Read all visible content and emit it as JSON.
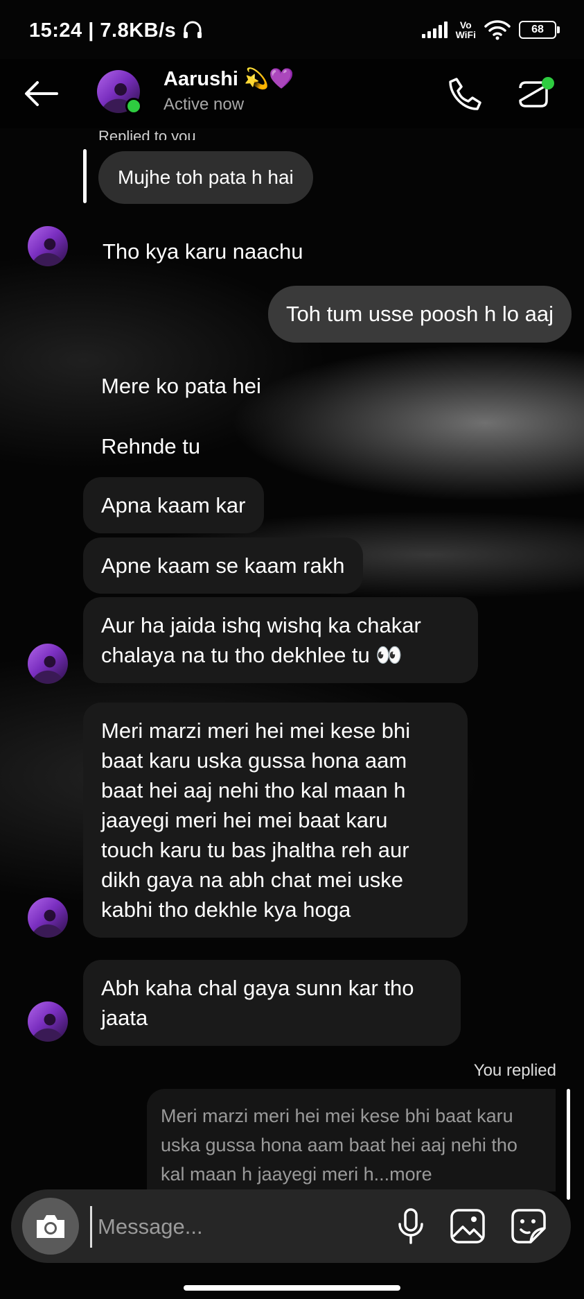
{
  "status_bar": {
    "time": "15:24 | 7.8KB/s",
    "vowifi_top": "Vo",
    "vowifi_bottom": "WiFi",
    "battery": "68"
  },
  "header": {
    "contact_name": "Aarushi 💫💜",
    "status": "Active now"
  },
  "thread": {
    "replied_label": "Replied to you",
    "reply_quote": "Mujhe toh pata h hai",
    "messages": [
      "Tho kya karu naachu",
      "Toh tum usse poosh h lo aaj",
      "Mere ko pata hei",
      "Rehnde tu",
      "Apna kaam kar",
      "Apne kaam se kaam rakh",
      "Aur ha jaida ishq wishq ka chakar\nchalaya na tu tho dekhlee tu 👀",
      "Meri marzi meri hei mei kese bhi\nbaat karu uska gussa hona aam\nbaat hei aaj nehi tho kal maan h\njaayegi meri hei mei baat karu\ntouch karu tu bas jhaltha reh aur\ndikh gaya na abh chat mei uske\nkabhi tho dekhle kya hoga",
      "Abh kaha chal gaya sunn kar tho\njaata"
    ],
    "you_replied_label": "You replied",
    "quoted_message": "Meri marzi meri hei mei kese bhi baat karu uska gussa hona aam baat hei aaj nehi tho kal maan h jaayegi meri h...more"
  },
  "composer": {
    "placeholder": "Message..."
  },
  "colors": {
    "background": "#000000",
    "received_bubble": "#1a1a1a",
    "sent_bubble": "#3a3a3a",
    "online": "#2ecc40",
    "avatar_accent": "#9b4fd8"
  },
  "icons": [
    "back-arrow-icon",
    "phone-icon",
    "video-call-icon",
    "camera-icon",
    "microphone-icon",
    "gallery-icon",
    "sticker-icon",
    "headphones-icon",
    "wifi-icon",
    "signal-icon",
    "battery-icon"
  ]
}
